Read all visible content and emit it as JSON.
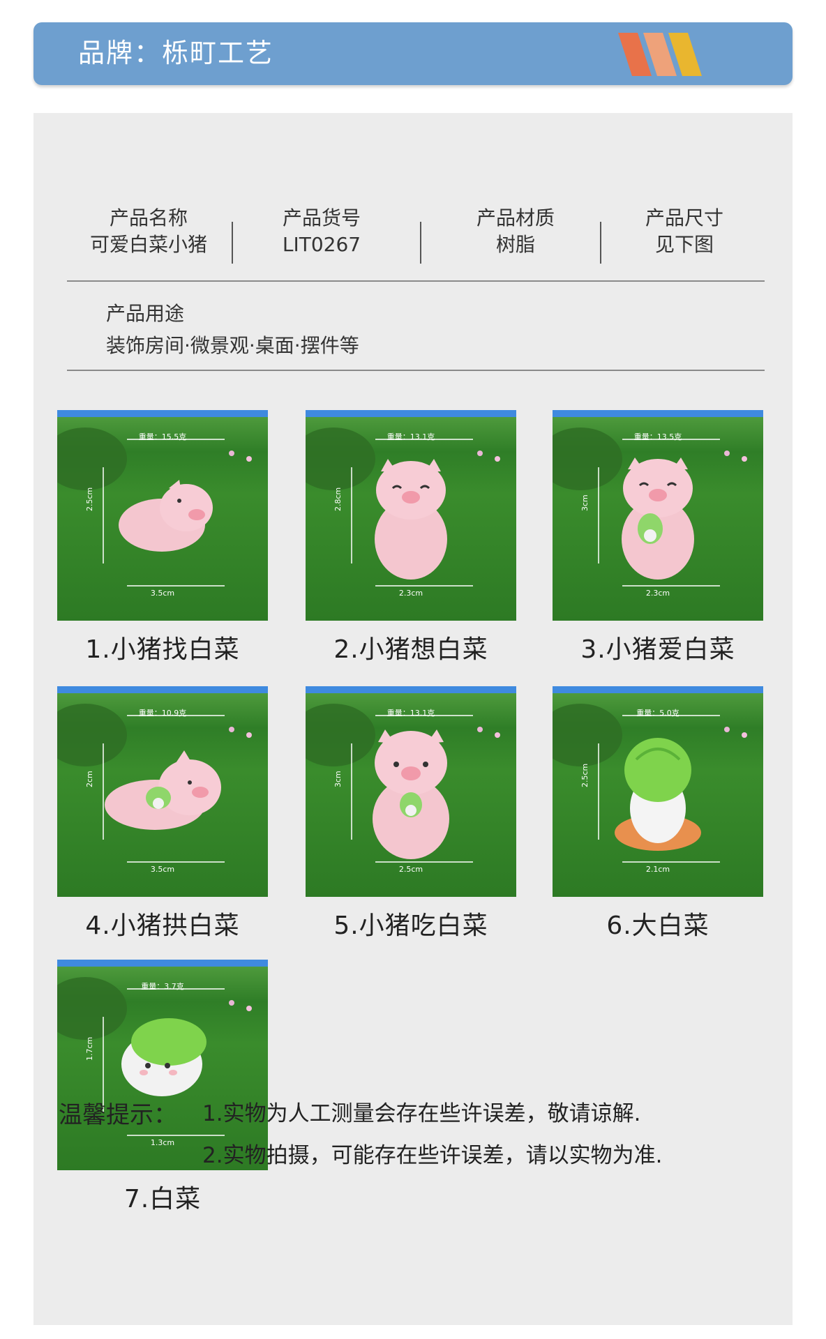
{
  "banner": {
    "title": "品牌：栎町工艺",
    "stripe_colors": [
      "#e8724a",
      "#eea27a",
      "#e9b62f"
    ]
  },
  "specs": [
    {
      "label": "产品名称",
      "value": "可爱白菜小猪"
    },
    {
      "label": "产品货号",
      "value": "LIT0267"
    },
    {
      "label": "产品材质",
      "value": "树脂"
    },
    {
      "label": "产品尺寸",
      "value": "见下图"
    }
  ],
  "usage": {
    "label": "产品用途",
    "value": "装饰房间·微景观·桌面·摆件等"
  },
  "products": [
    {
      "caption": "1.小猪找白菜",
      "weight": "重量：15.5克",
      "height": "2.5cm",
      "width": "3.5cm",
      "figure": "pig-lying-icon"
    },
    {
      "caption": "2.小猪想白菜",
      "weight": "重量：13.1克",
      "height": "2.8cm",
      "width": "2.3cm",
      "figure": "pig-sitting-icon"
    },
    {
      "caption": "3.小猪爱白菜",
      "weight": "重量：13.5克",
      "height": "3cm",
      "width": "2.3cm",
      "figure": "pig-holding-cabbage-icon"
    },
    {
      "caption": "4.小猪拱白菜",
      "weight": "重量：10.9克",
      "height": "2cm",
      "width": "3.5cm",
      "figure": "pig-lying-cabbage-icon"
    },
    {
      "caption": "5.小猪吃白菜",
      "weight": "重量：13.1克",
      "height": "3cm",
      "width": "2.5cm",
      "figure": "pig-eating-cabbage-icon"
    },
    {
      "caption": "6.大白菜",
      "weight": "重量：5.0克",
      "height": "2.5cm",
      "width": "2.1cm",
      "figure": "big-cabbage-icon"
    },
    {
      "caption": "7.白菜",
      "weight": "重量：3.7克",
      "height": "1.7cm",
      "width": "1.3cm",
      "figure": "cabbage-face-icon"
    }
  ],
  "tips": {
    "label": "温馨提示：",
    "lines": [
      "1.实物为人工测量会存在些许误差，敬请谅解.",
      "2.实物拍摄，可能存在些许误差，请以实物为准."
    ]
  }
}
